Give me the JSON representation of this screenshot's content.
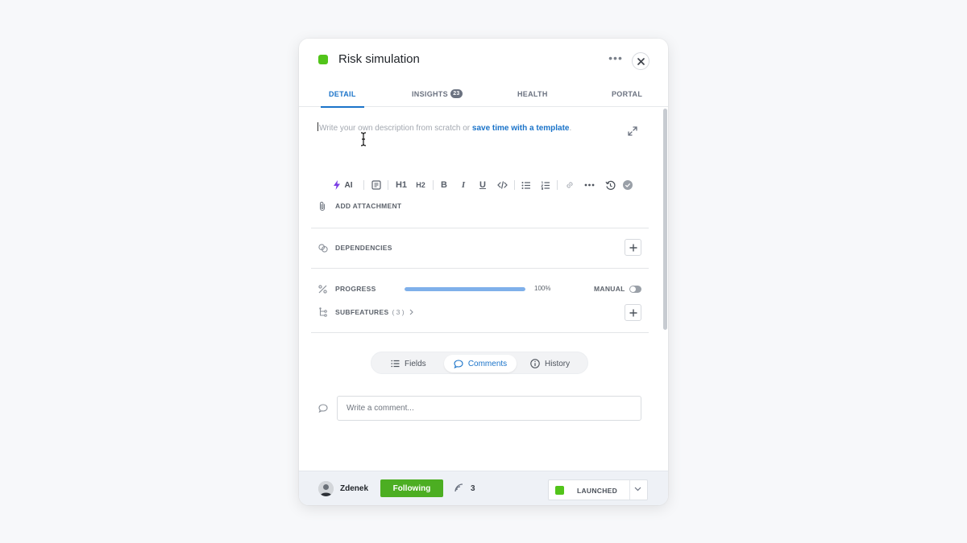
{
  "header": {
    "title": "Risk simulation",
    "status_color": "#52c41a",
    "more_label": "•••"
  },
  "tabs": [
    {
      "label": "DETAIL",
      "active": true
    },
    {
      "label": "INSIGHTS",
      "badge": "23"
    },
    {
      "label": "HEALTH"
    },
    {
      "label": "PORTAL"
    }
  ],
  "description": {
    "placeholder": "Write your own description from scratch or ",
    "template_link": "save time with a template",
    "suffix": "."
  },
  "toolbar": {
    "ai_label": "AI",
    "h1_label": "H1",
    "h2_label": "H2",
    "bold_label": "B",
    "italic_label": "I",
    "underline_label": "U"
  },
  "attachment": {
    "label": "ADD ATTACHMENT"
  },
  "dependencies": {
    "label": "DEPENDENCIES"
  },
  "progress": {
    "label": "PROGRESS",
    "value": 100,
    "value_text": "100%",
    "manual_label": "MANUAL",
    "manual_on": false
  },
  "subfeatures": {
    "label": "SUBFEATURES",
    "count_text": "( 3 )"
  },
  "segments": [
    {
      "label": "Fields",
      "icon": "list-icon"
    },
    {
      "label": "Comments",
      "icon": "comment-icon",
      "active": true
    },
    {
      "label": "History",
      "icon": "info-icon"
    }
  ],
  "comment": {
    "placeholder": "Write a comment..."
  },
  "footer": {
    "user_name": "Zdenek",
    "follow_label": "Following",
    "watchers": "3",
    "status_label": "LAUNCHED",
    "status_color": "#52c41a",
    "follow_color": "#4cae22"
  }
}
